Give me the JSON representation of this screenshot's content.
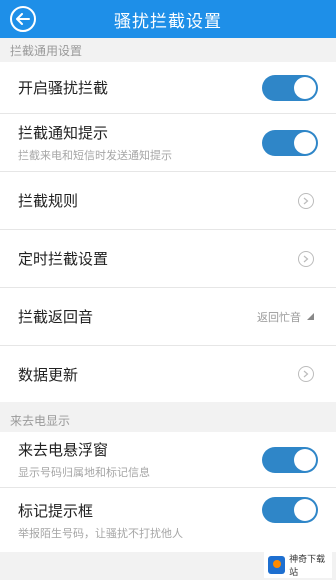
{
  "header": {
    "title": "骚扰拦截设置",
    "back_icon": "back-arrow-icon"
  },
  "sections": {
    "general": {
      "label": "拦截通用设置",
      "rows": {
        "enable": {
          "label": "开启骚扰拦截",
          "toggle_on": true
        },
        "notify": {
          "label": "拦截通知提示",
          "sub": "拦截来电和短信时发送通知提示",
          "toggle_on": true
        },
        "rules": {
          "label": "拦截规则"
        },
        "timer": {
          "label": "定时拦截设置"
        },
        "return_tone": {
          "label": "拦截返回音",
          "value": "返回忙音"
        },
        "data_update": {
          "label": "数据更新"
        }
      }
    },
    "caller": {
      "label": "来去电显示",
      "rows": {
        "floating": {
          "label": "来去电悬浮窗",
          "sub": "显示号码归属地和标记信息",
          "toggle_on": true
        },
        "mark": {
          "label": "标记提示框",
          "sub": "举报陌生号码，让骚扰不打扰他人",
          "toggle_on": true
        }
      }
    }
  },
  "watermark": {
    "text": "神奇下载站"
  },
  "colors": {
    "header": "#1e8fe8",
    "toggle": "#2f86c8",
    "background": "#f2f2f2"
  }
}
